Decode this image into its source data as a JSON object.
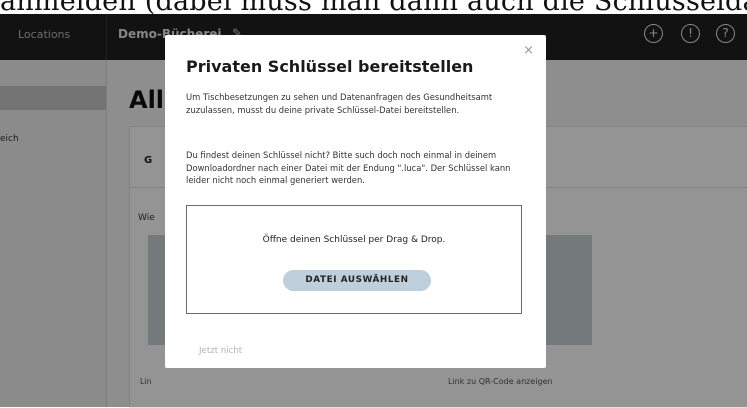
{
  "top_cutoff_text": "anmelden (dabei muss man dann auch die Schlüsseldatei",
  "header": {
    "nav_locations": "Locations",
    "app_title": "Demo-Bücherei",
    "edit_icon": "pencil-icon",
    "icons": [
      "plus-circle-icon",
      "info-circle-icon",
      "help-circle-icon"
    ]
  },
  "sidebar": {
    "sub_item_text": "eich"
  },
  "main": {
    "heading": "All",
    "tab_label": "G",
    "subtext": "Wie",
    "qr_links": [
      "Lin",
      "",
      "Link zu QR-Code anzeigen"
    ]
  },
  "modal": {
    "title": "Privaten Schlüssel bereitstellen",
    "paragraph1": "Um Tischbesetzungen zu sehen und Datenanfragen des Gesundheitsamt zuzulassen, musst du deine private Schlüssel-Datei bereitstellen.",
    "paragraph2": "Du findest deinen Schlüssel nicht? Bitte such doch noch einmal in deinem Downloadordner nach einer Datei mit der Endung \".luca\". Der Schlüssel kann leider nicht noch einmal generiert werden.",
    "dropzone_text": "Öffne deinen Schlüssel per Drag & Drop.",
    "select_button": "DATEI AUSWÄHLEN",
    "not_now": "Jetzt nicht",
    "close_symbol": "×"
  },
  "colors": {
    "header_bg": "#1f1f1f",
    "button_bg": "#bfcedb",
    "overlay": "rgba(0,0,0,0.42)"
  }
}
